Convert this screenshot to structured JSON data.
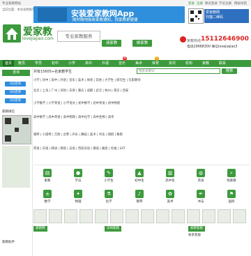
{
  "topbar": {
    "left": "专业家教网站",
    "right_items": [
      "登录",
      "注册",
      "教员登录",
      "学员注册",
      "网站导航"
    ]
  },
  "infobar": {
    "text": "当前位置：本站家教服务 - 找家教 - 学生 - 家长 - 代理 - 合作 - 高考 - Let's go",
    "date": "2019年8月15日"
  },
  "banner": {
    "title": "安装爱家教网App",
    "subtitle": "随时随地接收家教通知，找家教更便捷"
  },
  "header_right": {
    "app_text": "爱家教网",
    "app_sub": "扫描二维码",
    "phone_label": "家教热线",
    "phone": "15112646900",
    "alt_phone": "电话29668300 微信lovejiajiao3"
  },
  "brand": {
    "name": "爱家教",
    "domain": "lovejiajiao.com",
    "slogan": "专业家教服务"
  },
  "buttons": {
    "find_tutor": "请家教",
    "be_tutor": "做家教"
  },
  "nav": {
    "items": [
      "首页",
      "教员",
      "学员",
      "初中",
      "小学",
      "高中",
      "外语",
      "音乐",
      "美术",
      "体育",
      "资讯",
      "机构",
      "家教",
      "联系"
    ],
    "badges": [
      "4",
      "5"
    ]
  },
  "sidebar": {
    "title": "咨询",
    "qq_label": "QQ咨询",
    "qr_caption": "家教微信",
    "footer_title": "家教助手"
  },
  "search": {
    "count_text": "共有15605+名家教学生",
    "placeholder": "搜索关键词",
    "button": "搜索"
  },
  "categories": {
    "rows": [
      "小学 | 初中 | 高中 | 外语 | 音乐 | 美术 | 体育 | 其他 | 大学生 | 研究生 | 在职教师",
      "北京 | 上海 | 广州 | 深圳 | 天津 | 重庆 | 成都 | 武汉 | 杭州 | 南京 | 西安",
      "小学数学 | 小学英语 | 小学语文 | 初中数学 | 初中英语 | 初中物理",
      "高中数学 | 高中英语 | 高中物理 | 高中化学 | 高中生物 | 高考",
      "钢琴 | 小提琴 | 吉他 | 古筝 | 声乐 | 舞蹈 | 美术 | 书法 | 围棋 | 象棋",
      "英语 | 日语 | 韩语 | 德语 | 法语 | 西班牙语 | 俄语 | 雅思 | 托福 | SAT"
    ]
  },
  "icons_grid": [
    {
      "label": "家教"
    },
    {
      "label": "学员"
    },
    {
      "label": "小学生"
    },
    {
      "label": "初中生"
    },
    {
      "label": "高中生"
    },
    {
      "label": "英语"
    },
    {
      "label": "找家教"
    },
    {
      "label": "数学"
    },
    {
      "label": "物理"
    },
    {
      "label": "化学"
    },
    {
      "label": "钢琴"
    },
    {
      "label": "美术"
    },
    {
      "label": "书法"
    },
    {
      "label": "国际"
    }
  ],
  "bottom": {
    "left_tab": "家教网",
    "middle_tab": "深圳家教",
    "right_tab": "家教客服",
    "right_sub": "联系客服"
  }
}
